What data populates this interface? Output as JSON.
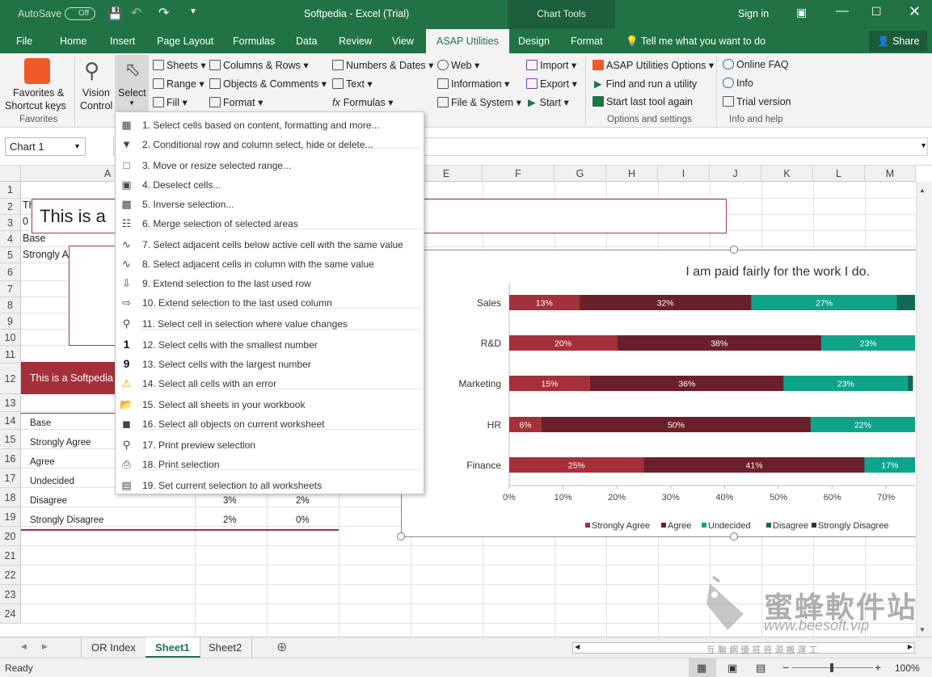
{
  "titlebar": {
    "autosave": "AutoSave",
    "autosave_state": "Off",
    "doc_title": "Softpedia - Excel (Trial)",
    "chart_tools": "Chart Tools",
    "sign_in": "Sign in"
  },
  "tabs": [
    "File",
    "Home",
    "Insert",
    "Page Layout",
    "Formulas",
    "Data",
    "Review",
    "View",
    "ASAP Utilities",
    "Design",
    "Format"
  ],
  "tell_me": "Tell me what you want to do",
  "share": "Share",
  "ribbon": {
    "favorites": {
      "label1": "Favorites &",
      "label2": "Shortcut keys",
      "group": "Favorites"
    },
    "vision": {
      "label1": "Vision",
      "label2": "Control"
    },
    "select": {
      "label": "Select"
    },
    "col1": [
      "Sheets",
      "Range",
      "Fill"
    ],
    "col2": [
      "Columns & Rows",
      "Objects & Comments",
      "Format"
    ],
    "col3": [
      "Numbers & Dates",
      "Text",
      "Formulas"
    ],
    "col4": [
      "Web",
      "Information",
      "File & System"
    ],
    "col5": [
      "Import",
      "Export",
      "Start"
    ],
    "col6": [
      "ASAP Utilities Options",
      "Find and run a utility",
      "Start last tool again"
    ],
    "col6_group": "Options and settings",
    "col7": [
      "Online FAQ",
      "Info",
      "Trial version"
    ],
    "col7_group": "Info and help"
  },
  "namebox": "Chart 1",
  "columns": [
    "A",
    "B",
    "C",
    "D",
    "E",
    "F",
    "G",
    "H",
    "I",
    "J",
    "K",
    "L",
    "M"
  ],
  "rows": [
    "1",
    "2",
    "3",
    "4",
    "5",
    "6",
    "7",
    "8",
    "9",
    "10",
    "11",
    "12",
    "13",
    "14",
    "15",
    "16",
    "17",
    "18",
    "19",
    "20",
    "21",
    "22",
    "23",
    "24"
  ],
  "cells": {
    "r2": "Th",
    "r3": "0",
    "r4": "Base",
    "r5": "Strongly A",
    "banner_text": "This is a",
    "red_banner": "This is a Softpedia",
    "table_labels": [
      "Base",
      "Strongly Agree",
      "Agree",
      "Undecided",
      "Disagree",
      "Strongly Disagree"
    ],
    "r18b": "3%",
    "r18c": "2%",
    "r19b": "2%",
    "r19c": "0%"
  },
  "menu": {
    "items": [
      {
        "label": "1. Select cells based on content, formatting and more...",
        "icon": "filter-grid-icon"
      },
      {
        "label": "2. Conditional row and column select, hide or delete...",
        "icon": "funnel-icon"
      },
      {
        "label": "3. Move or resize selected range...",
        "icon": "move-range-icon"
      },
      {
        "label": "4. Deselect cells...",
        "icon": "eraser-icon"
      },
      {
        "label": "5. Inverse selection...",
        "icon": "inverse-icon"
      },
      {
        "label": "6. Merge selection of selected areas",
        "icon": "merge-icon"
      },
      {
        "label": "7. Select adjacent cells below active cell with the same value",
        "icon": "wave-icon"
      },
      {
        "label": "8. Select adjacent cells in column with the same value",
        "icon": "wave-icon"
      },
      {
        "label": "9. Extend selection to the last used row",
        "icon": "arrow-down-icon"
      },
      {
        "label": "10. Extend selection to the last used column",
        "icon": "arrow-right-icon"
      },
      {
        "label": "11. Select cell in selection where value changes",
        "icon": "magnifier-icon"
      },
      {
        "label": "12. Select cells with the smallest number",
        "icon": "digit-one-icon",
        "glyph": "1"
      },
      {
        "label": "13. Select cells with the largest number",
        "icon": "digit-nine-icon",
        "glyph": "9"
      },
      {
        "label": "14. Select all cells with an error",
        "icon": "error-icon"
      },
      {
        "label": "15. Select all sheets in your workbook",
        "icon": "sheets-icon"
      },
      {
        "label": "16. Select all objects on current worksheet",
        "icon": "objects-icon"
      },
      {
        "label": "17. Print preview selection",
        "icon": "print-preview-icon"
      },
      {
        "label": "18. Print selection",
        "icon": "printer-icon"
      },
      {
        "label": "19. Set current selection to all worksheets",
        "icon": "worksheet-icon"
      }
    ]
  },
  "chart_data": {
    "type": "bar",
    "orientation": "horizontal-stacked",
    "title": "I am paid fairly for the work I do.",
    "categories": [
      "Sales",
      "R&D",
      "Marketing",
      "HR",
      "Finance"
    ],
    "series": [
      {
        "name": "Strongly Agree",
        "color": "#a4303a",
        "values": [
          13,
          20,
          15,
          6,
          25
        ]
      },
      {
        "name": "Agree",
        "color": "#6b1f2a",
        "values": [
          32,
          38,
          36,
          50,
          41
        ]
      },
      {
        "name": "Undecided",
        "color": "#0fa38a",
        "values": [
          27,
          23,
          23,
          22,
          17
        ]
      },
      {
        "name": "Disagree",
        "color": "#0c6b55",
        "values": [
          4,
          3,
          1,
          1,
          1
        ]
      },
      {
        "name": "Strongly Disagree",
        "color": "#233a35",
        "values": [
          0,
          0,
          0,
          0,
          0
        ]
      }
    ],
    "data_labels": [
      [
        "13%",
        "32%",
        "27%"
      ],
      [
        "20%",
        "38%",
        "23%"
      ],
      [
        "15%",
        "36%",
        "23%"
      ],
      [
        "6%",
        "50%",
        "22%"
      ],
      [
        "25%",
        "41%",
        "17%"
      ]
    ],
    "xticks": [
      "0%",
      "10%",
      "20%",
      "30%",
      "40%",
      "50%",
      "60%",
      "70%"
    ],
    "xlim": [
      0,
      76
    ],
    "legend_position": "bottom"
  },
  "sheets": [
    "OR Index",
    "Sheet1",
    "Sheet2"
  ],
  "status": {
    "text": "Ready",
    "zoom": "100%"
  },
  "watermark": {
    "text": "蜜蜂軟件站",
    "url": "www.beesoft.vip",
    "sub": "互 聯 網 優 質 資 源 搬 運 工"
  }
}
